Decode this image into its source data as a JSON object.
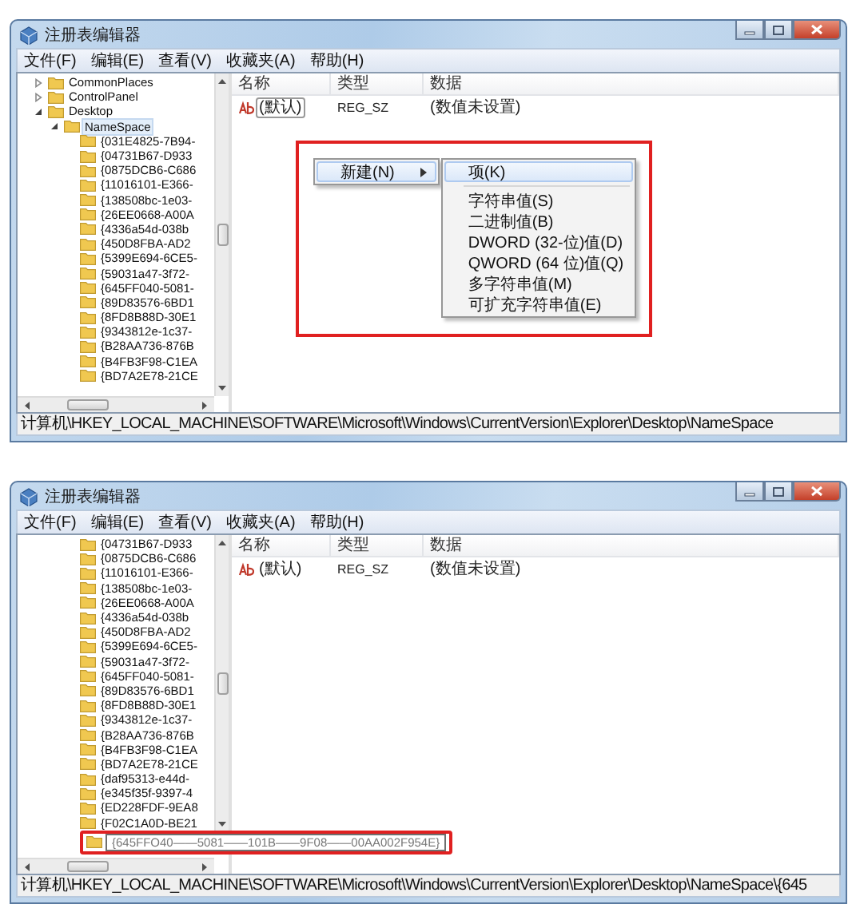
{
  "windows": [
    {
      "title": "注册表编辑器",
      "menu": [
        "文件(F)",
        "编辑(E)",
        "查看(V)",
        "收藏夹(A)",
        "帮助(H)"
      ],
      "tree": {
        "items": [
          {
            "label": "CommonPlaces",
            "expanded": false,
            "selected": false
          },
          {
            "label": "ControlPanel",
            "expanded": false,
            "selected": false
          },
          {
            "label": "Desktop",
            "expanded": true,
            "selected": false,
            "children": [
              {
                "label": "NameSpace",
                "expanded": true,
                "selected": true,
                "children": [
                  {
                    "label": "{031E4825-7B94-",
                    "selected": false
                  },
                  {
                    "label": "{04731B67-D933",
                    "selected": false
                  },
                  {
                    "label": "{0875DCB6-C686",
                    "selected": false
                  },
                  {
                    "label": "{11016101-E366-",
                    "selected": false
                  },
                  {
                    "label": "{138508bc-1e03-",
                    "selected": false
                  },
                  {
                    "label": "{26EE0668-A00A",
                    "selected": false
                  },
                  {
                    "label": "{4336a54d-038b",
                    "selected": false
                  },
                  {
                    "label": "{450D8FBA-AD2",
                    "selected": false
                  },
                  {
                    "label": "{5399E694-6CE5-",
                    "selected": false
                  },
                  {
                    "label": "{59031a47-3f72-",
                    "selected": false
                  },
                  {
                    "label": "{645FF040-5081-",
                    "selected": false
                  },
                  {
                    "label": "{89D83576-6BD1",
                    "selected": false
                  },
                  {
                    "label": "{8FD8B88D-30E1",
                    "selected": false
                  },
                  {
                    "label": "{9343812e-1c37-",
                    "selected": false
                  },
                  {
                    "label": "{B28AA736-876B",
                    "selected": false
                  },
                  {
                    "label": "{B4FB3F98-C1EA",
                    "selected": false
                  },
                  {
                    "label": "{BD7A2E78-21CE",
                    "selected": false
                  }
                ]
              }
            ]
          }
        ]
      },
      "list": {
        "columns": [
          "名称",
          "类型",
          "数据"
        ],
        "rows": [
          {
            "name": "(默认)",
            "type": "REG_SZ",
            "data": "(数值未设置)",
            "focused": true
          }
        ]
      },
      "context_menu": {
        "highlighted": true,
        "items": [
          {
            "label": "新建(N)",
            "selected": true,
            "submenu": {
              "items": [
                {
                  "kind": "item",
                  "label": "项(K)",
                  "selected": true
                },
                {
                  "kind": "separator"
                },
                {
                  "kind": "item",
                  "label": "字符串值(S)",
                  "selected": false
                },
                {
                  "kind": "item",
                  "label": "二进制值(B)",
                  "selected": false
                },
                {
                  "kind": "item",
                  "label": "DWORD (32-位)值(D)",
                  "selected": false
                },
                {
                  "kind": "item",
                  "label": "QWORD (64 位)值(Q)",
                  "selected": false
                },
                {
                  "kind": "item",
                  "label": "多字符串值(M)",
                  "selected": false
                },
                {
                  "kind": "item",
                  "label": "可扩充字符串值(E)",
                  "selected": false
                }
              ]
            }
          }
        ]
      },
      "status_bar": "计算机\\HKEY_LOCAL_MACHINE\\SOFTWARE\\Microsoft\\Windows\\CurrentVersion\\Explorer\\Desktop\\NameSpace"
    },
    {
      "title": "注册表编辑器",
      "menu": [
        "文件(F)",
        "编辑(E)",
        "查看(V)",
        "收藏夹(A)",
        "帮助(H)"
      ],
      "tree": {
        "items": [
          {
            "label": "{04731B67-D933",
            "selected": false,
            "editing": false
          },
          {
            "label": "{0875DCB6-C686",
            "selected": false,
            "editing": false
          },
          {
            "label": "{11016101-E366-",
            "selected": false,
            "editing": false
          },
          {
            "label": "{138508bc-1e03-",
            "selected": false,
            "editing": false
          },
          {
            "label": "{26EE0668-A00A",
            "selected": false,
            "editing": false
          },
          {
            "label": "{4336a54d-038b",
            "selected": false,
            "editing": false
          },
          {
            "label": "{450D8FBA-AD2",
            "selected": false,
            "editing": false
          },
          {
            "label": "{5399E694-6CE5-",
            "selected": false,
            "editing": false
          },
          {
            "label": "{59031a47-3f72-",
            "selected": false,
            "editing": false
          },
          {
            "label": "{645FF040-5081-",
            "selected": false,
            "editing": false
          },
          {
            "label": "{89D83576-6BD1",
            "selected": false,
            "editing": false
          },
          {
            "label": "{8FD8B88D-30E1",
            "selected": false,
            "editing": false
          },
          {
            "label": "{9343812e-1c37-",
            "selected": false,
            "editing": false
          },
          {
            "label": "{B28AA736-876B",
            "selected": false,
            "editing": false
          },
          {
            "label": "{B4FB3F98-C1EA",
            "selected": false,
            "editing": false
          },
          {
            "label": "{BD7A2E78-21CE",
            "selected": false,
            "editing": false
          },
          {
            "label": "{daf95313-e44d-",
            "selected": false,
            "editing": false
          },
          {
            "label": "{e345f35f-9397-4",
            "selected": false,
            "editing": false
          },
          {
            "label": "{ED228FDF-9EA8",
            "selected": false,
            "editing": false
          },
          {
            "label": "{F02C1A0D-BE21",
            "selected": false,
            "editing": false
          },
          {
            "label": "{645FFO40——5081——101B——9F08——00AA002F954E}",
            "selected": false,
            "editing": true,
            "highlighted": true
          }
        ]
      },
      "list": {
        "columns": [
          "名称",
          "类型",
          "数据"
        ],
        "rows": [
          {
            "name": "(默认)",
            "type": "REG_SZ",
            "data": "(数值未设置)",
            "focused": false
          }
        ]
      },
      "status_bar": "计算机\\HKEY_LOCAL_MACHINE\\SOFTWARE\\Microsoft\\Windows\\CurrentVersion\\Explorer\\Desktop\\NameSpace\\{645"
    }
  ]
}
